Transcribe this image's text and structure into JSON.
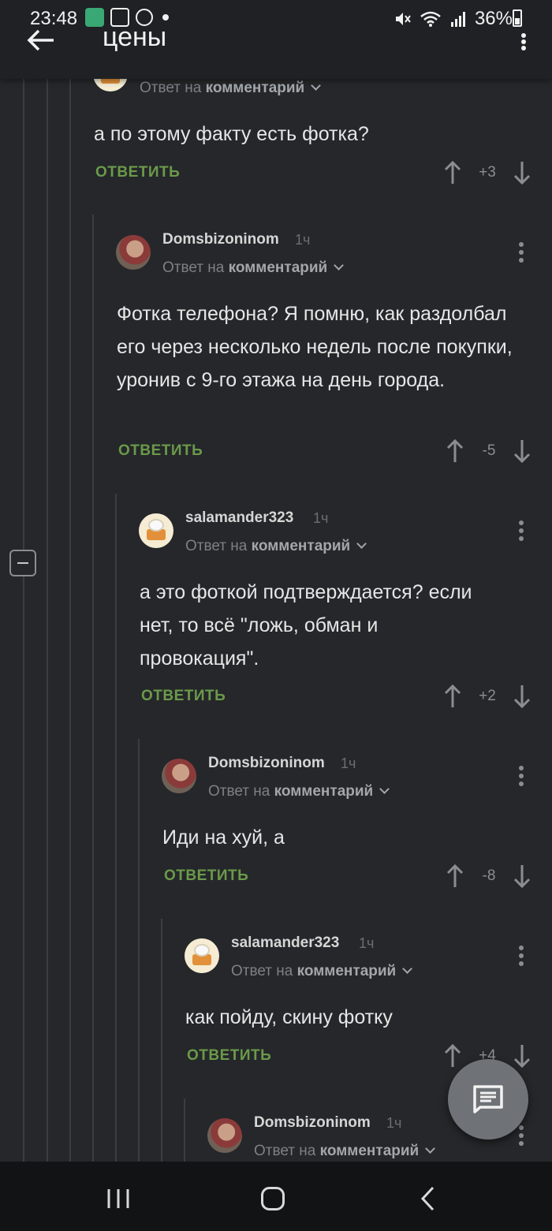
{
  "status_bar": {
    "time": "23:48",
    "battery": "36%"
  },
  "header": {
    "title": "цены"
  },
  "common": {
    "reply_prefix": "Ответ на",
    "reply_target": "комментарий",
    "reply_button": "ОТВЕТИТЬ"
  },
  "comments": [
    {
      "text": "а по этому факту есть фотка?",
      "score": "+3"
    },
    {
      "username": "Domsbizoninom",
      "time": "1ч",
      "text": "Фотка телефона? Я помню, как раздолбал его через несколько недель после покупки, уронив с 9-го этажа на день города.",
      "score": "-5"
    },
    {
      "username": "salamander323",
      "time": "1ч",
      "text": "а это фоткой подтверждается? если нет, то всё \"ложь, обман и провокация\".",
      "score": "+2"
    },
    {
      "username": "Domsbizoninom",
      "time": "1ч",
      "text": "Иди на хуй, а",
      "score": "-8"
    },
    {
      "username": "salamander323",
      "time": "1ч",
      "text": "как пойду, скину фотку",
      "score": "+4"
    },
    {
      "username": "Domsbizoninom",
      "time": "1ч"
    }
  ],
  "colors": {
    "background": "#25272a",
    "accent_green": "#6b9a4a",
    "fab": "#6f7276"
  }
}
